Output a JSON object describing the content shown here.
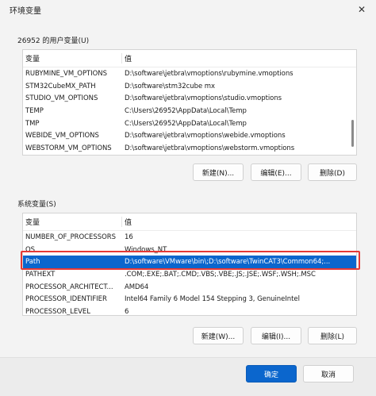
{
  "window": {
    "title": "环境变量",
    "close_glyph": "✕"
  },
  "user_section": {
    "label": "26952 的用户变量(U)",
    "columns": {
      "variable": "变量",
      "value": "值"
    },
    "rows": [
      {
        "variable": "RUBYMINE_VM_OPTIONS",
        "value": "D:\\software\\jetbra\\vmoptions\\rubymine.vmoptions"
      },
      {
        "variable": "STM32CubeMX_PATH",
        "value": "D:\\software\\stm32cube mx"
      },
      {
        "variable": "STUDIO_VM_OPTIONS",
        "value": "D:\\software\\jetbra\\vmoptions\\studio.vmoptions"
      },
      {
        "variable": "TEMP",
        "value": "C:\\Users\\26952\\AppData\\Local\\Temp"
      },
      {
        "variable": "TMP",
        "value": "C:\\Users\\26952\\AppData\\Local\\Temp"
      },
      {
        "variable": "WEBIDE_VM_OPTIONS",
        "value": "D:\\software\\jetbra\\vmoptions\\webide.vmoptions"
      },
      {
        "variable": "WEBSTORM_VM_OPTIONS",
        "value": "D:\\software\\jetbra\\vmoptions\\webstorm.vmoptions"
      }
    ],
    "buttons": {
      "new": "新建(N)...",
      "edit": "编辑(E)...",
      "delete": "删除(D)"
    }
  },
  "system_section": {
    "label": "系统变量(S)",
    "columns": {
      "variable": "变量",
      "value": "值"
    },
    "rows": [
      {
        "variable": "NUMBER_OF_PROCESSORS",
        "value": "16"
      },
      {
        "variable": "OS",
        "value": "Windows_NT"
      },
      {
        "variable": "Path",
        "value": "D:\\software\\VMware\\bin\\;D:\\software\\TwinCAT3\\Common64;..."
      },
      {
        "variable": "PATHEXT",
        "value": ".COM;.EXE;.BAT;.CMD;.VBS;.VBE;.JS;.JSE;.WSF;.WSH;.MSC"
      },
      {
        "variable": "PROCESSOR_ARCHITECT...",
        "value": "AMD64"
      },
      {
        "variable": "PROCESSOR_IDENTIFIER",
        "value": "Intel64 Family 6 Model 154 Stepping 3, GenuineIntel"
      },
      {
        "variable": "PROCESSOR_LEVEL",
        "value": "6"
      }
    ],
    "selected_index": 2,
    "buttons": {
      "new": "新建(W)...",
      "edit": "编辑(I)...",
      "delete": "删除(L)"
    }
  },
  "footer": {
    "ok": "确定",
    "cancel": "取消"
  },
  "colors": {
    "selection": "#0b66cd",
    "highlight_border": "#e53935",
    "window_bg": "#f3f3f3"
  }
}
